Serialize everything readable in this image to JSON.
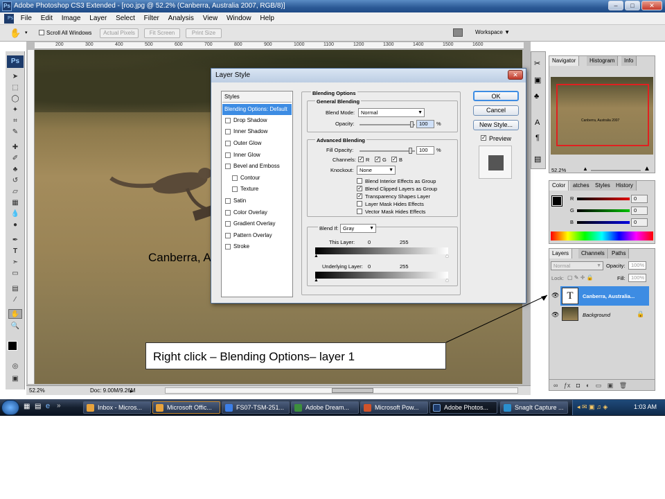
{
  "app": {
    "title": "Adobe Photoshop CS3 Extended - [roo.jpg @ 52.2% (Canberra, Australia 2007, RGB/8)]",
    "ps_badge": "Ps"
  },
  "menu": [
    "File",
    "Edit",
    "Image",
    "Layer",
    "Select",
    "Filter",
    "Analysis",
    "View",
    "Window",
    "Help"
  ],
  "options_bar": {
    "scroll_all": "Scroll All Windows",
    "actual_pixels": "Actual Pixels",
    "fit_screen": "Fit Screen",
    "print_size": "Print Size",
    "workspace": "Workspace ▼"
  },
  "ruler_ticks": [
    "200",
    "300",
    "400",
    "500",
    "600",
    "700",
    "800",
    "900",
    "1000",
    "1100",
    "1200",
    "1300",
    "1400",
    "1500",
    "1600"
  ],
  "canvas": {
    "overlay_text": "Canberra, A",
    "zoom": "52.2%",
    "doc_info": "Doc: 9.00M/9.26M"
  },
  "layer_style": {
    "title": "Layer Style",
    "styles_header": "Styles",
    "styles": [
      {
        "label": "Blending Options: Default",
        "selected": true,
        "checkbox": false
      },
      {
        "label": "Drop Shadow",
        "checkbox": true
      },
      {
        "label": "Inner Shadow",
        "checkbox": true
      },
      {
        "label": "Outer Glow",
        "checkbox": true
      },
      {
        "label": "Inner Glow",
        "checkbox": true
      },
      {
        "label": "Bevel and Emboss",
        "checkbox": true
      },
      {
        "label": "Contour",
        "checkbox": true,
        "indent": true
      },
      {
        "label": "Texture",
        "checkbox": true,
        "indent": true
      },
      {
        "label": "Satin",
        "checkbox": true
      },
      {
        "label": "Color Overlay",
        "checkbox": true
      },
      {
        "label": "Gradient Overlay",
        "checkbox": true
      },
      {
        "label": "Pattern Overlay",
        "checkbox": true
      },
      {
        "label": "Stroke",
        "checkbox": true
      }
    ],
    "blending_options": "Blending Options",
    "general_blending": "General Blending",
    "blend_mode_label": "Blend Mode:",
    "blend_mode": "Normal",
    "opacity_label": "Opacity:",
    "opacity": "100",
    "percent": "%",
    "advanced_blending": "Advanced Blending",
    "fill_opacity_label": "Fill Opacity:",
    "fill_opacity": "100",
    "channels_label": "Channels:",
    "channels": [
      "R",
      "G",
      "B"
    ],
    "knockout_label": "Knockout:",
    "knockout": "None",
    "options": [
      {
        "label": "Blend Interior Effects as Group",
        "checked": false
      },
      {
        "label": "Blend Clipped Layers as Group",
        "checked": true
      },
      {
        "label": "Transparency Shapes Layer",
        "checked": true
      },
      {
        "label": "Layer Mask Hides Effects",
        "checked": false
      },
      {
        "label": "Vector Mask Hides Effects",
        "checked": false
      }
    ],
    "blend_if_label": "Blend If:",
    "blend_if": "Gray",
    "this_layer_label": "This Layer:",
    "underlying_label": "Underlying Layer:",
    "range_min": "0",
    "range_max": "255",
    "ok": "OK",
    "cancel": "Cancel",
    "new_style": "New Style...",
    "preview": "Preview"
  },
  "navigator": {
    "tabs": [
      "Navigator",
      "Histogram",
      "Info"
    ],
    "zoom": "52.2%",
    "thumb_text": "Canberra, Australia 2007"
  },
  "color_panel": {
    "tabs": [
      "Color",
      "Swatches",
      "Styles",
      "History"
    ],
    "tab_labels_shown": [
      "Color",
      "atches",
      "Styles",
      "History"
    ],
    "channels": [
      {
        "label": "R",
        "value": "0",
        "color": "#d40000"
      },
      {
        "label": "G",
        "value": "0",
        "color": "#00a000"
      },
      {
        "label": "B",
        "value": "0",
        "color": "#0000d4"
      }
    ]
  },
  "layers_panel": {
    "tabs": [
      "Layers",
      "Channels",
      "Paths"
    ],
    "mode": "Normal",
    "opacity_label": "Opacity:",
    "opacity": "100%",
    "lock_label": "Lock:",
    "fill_label": "Fill:",
    "fill": "100%",
    "layers": [
      {
        "name": "Canberra, Australia...",
        "type": "text",
        "thumb": "T",
        "selected": true
      },
      {
        "name": "Background",
        "type": "image",
        "selected": false,
        "locked": true
      }
    ]
  },
  "callout": "Right click – Blending Options– layer 1",
  "taskbar": {
    "items": [
      {
        "label": "Inbox - Micros...",
        "color": "#e8a33c"
      },
      {
        "label": "Microsoft Offic...",
        "color": "#e8a33c",
        "active": false
      },
      {
        "label": "FS07-TSM-251...",
        "color": "#3c7fe8"
      },
      {
        "label": "Adobe Dream...",
        "color": "#3d8f3d"
      },
      {
        "label": "Microsoft Pow...",
        "color": "#d0532a"
      },
      {
        "label": "Adobe Photos...",
        "color": "#1d3b6b",
        "active": true
      },
      {
        "label": "SnagIt Capture ...",
        "color": "#2a8fcf"
      }
    ],
    "time": "1:03 AM"
  }
}
